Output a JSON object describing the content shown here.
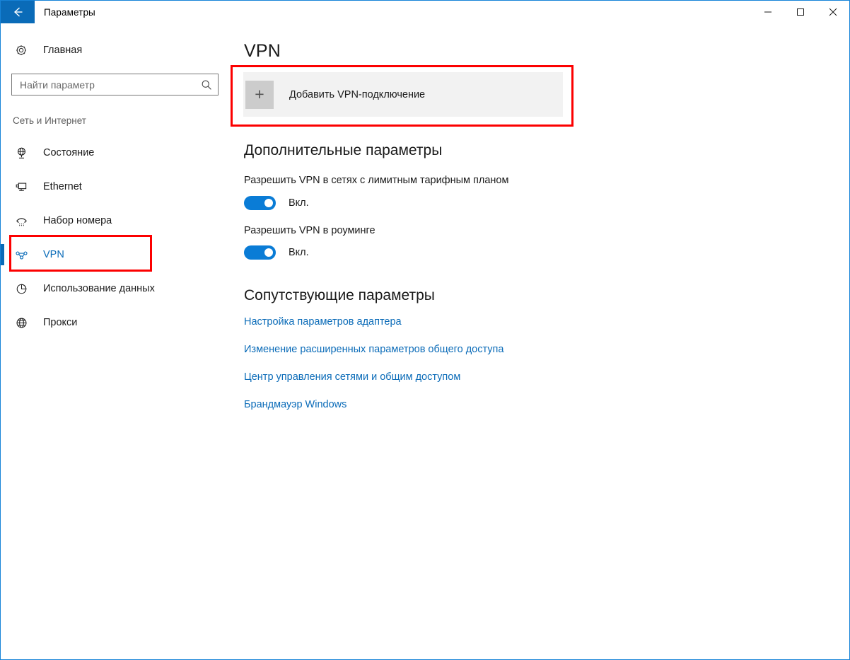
{
  "window": {
    "title": "Параметры",
    "back_icon": "back-arrow-icon",
    "minimize_label": "—",
    "maximize_label": "☐",
    "close_label": "✕",
    "border_color": "#1683d8"
  },
  "sidebar": {
    "home": {
      "label": "Главная",
      "icon": "gear-icon"
    },
    "search": {
      "placeholder": "Найти параметр",
      "value": "",
      "icon": "search-icon"
    },
    "group_label": "Сеть и Интернет",
    "items": [
      {
        "label": "Состояние",
        "icon": "network-status-icon",
        "selected": false
      },
      {
        "label": "Ethernet",
        "icon": "ethernet-icon",
        "selected": false
      },
      {
        "label": "Набор номера",
        "icon": "dial-up-phone-icon",
        "selected": false
      },
      {
        "label": "VPN",
        "icon": "vpn-icon",
        "selected": true
      },
      {
        "label": "Использование данных",
        "icon": "data-usage-pie-icon",
        "selected": false
      },
      {
        "label": "Прокси",
        "icon": "globe-proxy-icon",
        "selected": false
      }
    ]
  },
  "main": {
    "page_title": "VPN",
    "add_connection": {
      "label": "Добавить VPN-подключение",
      "icon": "plus-icon"
    },
    "advanced": {
      "heading": "Дополнительные параметры",
      "settings": [
        {
          "label": "Разрешить VPN в сетях с лимитным тарифным планом",
          "state": "Вкл.",
          "on": true
        },
        {
          "label": "Разрешить VPN в роуминге",
          "state": "Вкл.",
          "on": true
        }
      ]
    },
    "related": {
      "heading": "Сопутствующие параметры",
      "links": [
        "Настройка параметров адаптера",
        "Изменение расширенных параметров общего доступа",
        "Центр управления сетями и общим доступом",
        "Брандмауэр Windows"
      ]
    }
  },
  "annotations": {
    "highlight_color": "#fc0000",
    "boxes": [
      "sidebar-vpn-item",
      "add-vpn-connection-card"
    ]
  },
  "colors": {
    "accent": "#0a6bb8",
    "toggle_on": "#0a7cd6",
    "card_bg": "#f2f2f2",
    "plus_tile": "#cccccc"
  }
}
